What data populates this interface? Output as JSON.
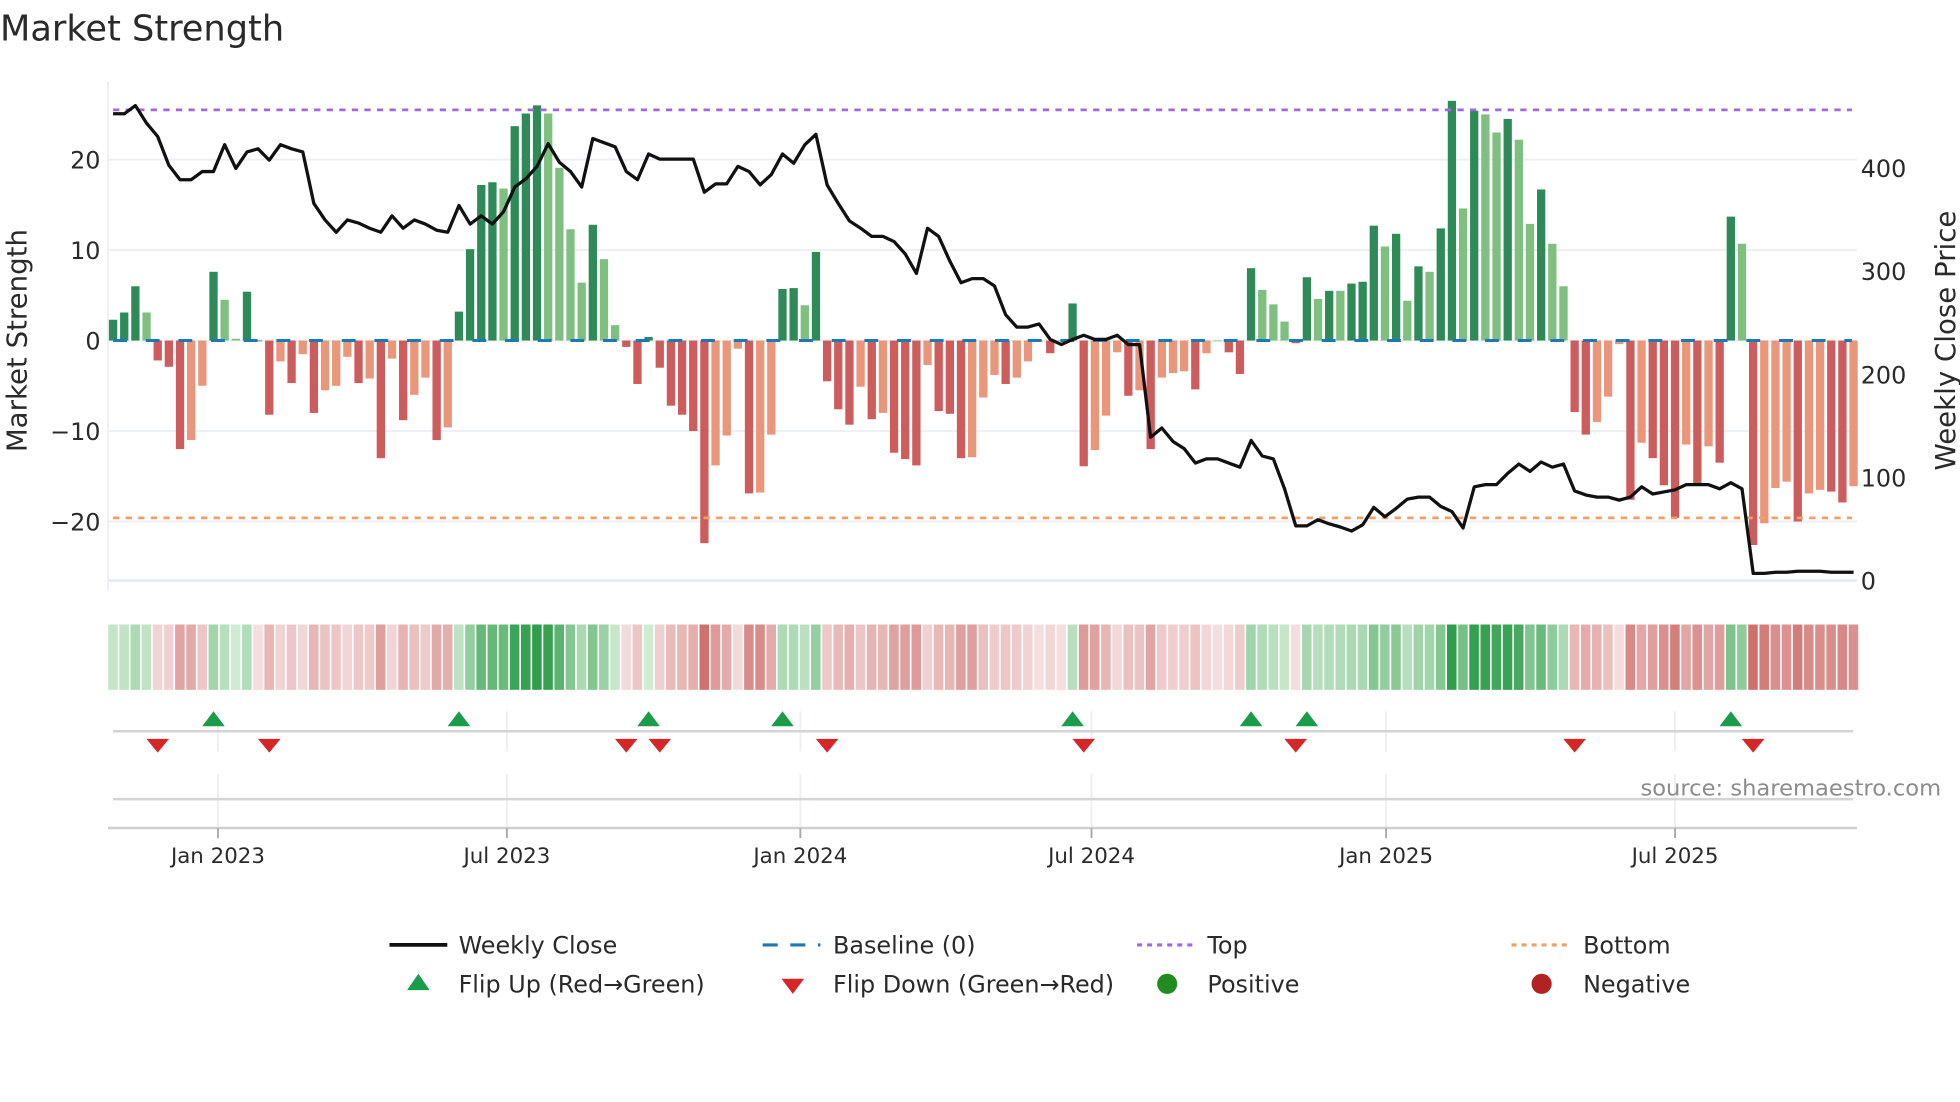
{
  "chart_data": {
    "type": "bar",
    "title": "Market Strength",
    "ylabel": "Market Strength",
    "y2label": "Weekly Close Price",
    "ylim": [
      -26.5,
      28.6
    ],
    "y2lim": [
      0,
      484
    ],
    "yticks": [
      {
        "v": 20,
        "label": "20"
      },
      {
        "v": 10,
        "label": "10"
      },
      {
        "v": 0,
        "label": "0"
      },
      {
        "v": -10,
        "label": "−10"
      },
      {
        "v": -20,
        "label": "−20"
      }
    ],
    "y2ticks": [
      {
        "v": 400,
        "label": "400"
      },
      {
        "v": 300,
        "label": "300"
      },
      {
        "v": 200,
        "label": "200"
      },
      {
        "v": 100,
        "label": "100"
      },
      {
        "v": 0,
        "label": "0"
      }
    ],
    "xticks": [
      {
        "week": 10.4,
        "label": "Jan 2023"
      },
      {
        "week": 36.3,
        "label": "Jul 2023"
      },
      {
        "week": 62.6,
        "label": "Jan 2024"
      },
      {
        "week": 88.7,
        "label": "Jul 2024"
      },
      {
        "week": 115.1,
        "label": "Jan 2025"
      },
      {
        "week": 141,
        "label": "Jul 2025"
      }
    ],
    "top_level": 25.5,
    "bottom_level": -19.6,
    "baseline": 0,
    "strength": [
      2.3,
      3.1,
      6.0,
      3.1,
      -2.2,
      -2.9,
      -12.0,
      -11.0,
      -5.0,
      7.6,
      4.5,
      0.2,
      5.4,
      0,
      -8.2,
      -2.3,
      -4.7,
      -1.5,
      -8.0,
      -5.5,
      -5.0,
      -1.8,
      -4.7,
      -4.2,
      -13.0,
      -2.0,
      -8.8,
      -6.0,
      -4.1,
      -11.0,
      -9.6,
      3.2,
      10.1,
      17.2,
      17.5,
      16.8,
      23.7,
      25.1,
      26.0,
      25.1,
      19.1,
      12.3,
      6.4,
      12.8,
      9.0,
      1.7,
      -0.7,
      -4.8,
      0.4,
      -3.0,
      -7.2,
      -8.2,
      -10.0,
      -22.4,
      -13.8,
      -10.5,
      -0.9,
      -16.9,
      -16.8,
      -10.4,
      5.7,
      5.8,
      3.9,
      9.8,
      -4.5,
      -7.6,
      -9.3,
      -5.1,
      -8.7,
      -8.0,
      -12.4,
      -13.1,
      -13.8,
      -2.7,
      -7.8,
      -8.1,
      -13.0,
      -12.9,
      -6.3,
      -3.8,
      -4.8,
      -4.1,
      -2.3,
      0,
      -1.4,
      0,
      4.1,
      -13.9,
      -12.1,
      -8.3,
      -1.3,
      -6.1,
      -5.5,
      -12.0,
      -4.1,
      -3.6,
      -3.4,
      -5.4,
      -1.4,
      0,
      -1.3,
      -3.7,
      8.0,
      5.6,
      4.0,
      2.1,
      -0.3,
      7.0,
      4.6,
      5.5,
      5.5,
      6.3,
      6.5,
      12.7,
      10.4,
      11.8,
      4.4,
      8.2,
      7.6,
      12.4,
      26.5,
      14.6,
      25.4,
      25.0,
      23.0,
      24.5,
      22.2,
      12.9,
      16.7,
      10.7,
      6.0,
      -7.9,
      -10.4,
      -9.0,
      -6.2,
      -0.4,
      -17.6,
      -11.3,
      -13.0,
      -16.0,
      -19.6,
      -11.5,
      -15.9,
      -11.7,
      -13.5,
      13.7,
      10.7,
      -22.6,
      -20.2,
      -16.3,
      -15.6,
      -20.0,
      -16.9,
      -16.5,
      -16.7,
      -17.9,
      -16.1
    ],
    "strong": [
      1,
      1,
      1,
      0,
      1,
      1,
      1,
      0,
      0,
      1,
      0,
      0,
      1,
      1,
      1,
      0,
      1,
      0,
      1,
      0,
      0,
      0,
      1,
      0,
      1,
      0,
      1,
      0,
      0,
      1,
      0,
      1,
      1,
      1,
      1,
      0,
      1,
      1,
      1,
      0,
      0,
      0,
      0,
      1,
      0,
      0,
      1,
      1,
      1,
      1,
      1,
      1,
      1,
      1,
      0,
      0,
      0,
      1,
      0,
      0,
      1,
      1,
      0,
      1,
      1,
      1,
      1,
      0,
      1,
      0,
      1,
      1,
      1,
      0,
      1,
      1,
      1,
      0,
      0,
      0,
      1,
      0,
      0,
      0,
      1,
      0,
      1,
      1,
      0,
      0,
      0,
      1,
      0,
      1,
      0,
      0,
      0,
      1,
      0,
      0,
      1,
      1,
      1,
      0,
      0,
      0,
      1,
      1,
      0,
      1,
      0,
      1,
      1,
      1,
      0,
      1,
      0,
      1,
      0,
      1,
      1,
      0,
      1,
      0,
      0,
      1,
      0,
      0,
      1,
      0,
      0,
      1,
      1,
      0,
      0,
      0,
      1,
      0,
      1,
      1,
      1,
      0,
      1,
      0,
      1,
      1,
      0,
      1,
      0,
      0,
      0,
      1,
      0,
      0,
      1,
      1,
      0
    ],
    "weekly_close": [
      453,
      453,
      461,
      444,
      431,
      403,
      389,
      389,
      397,
      397,
      423,
      400,
      416,
      419,
      408,
      423,
      419,
      416,
      366,
      350,
      338,
      350,
      347,
      342,
      338,
      354,
      342,
      350,
      346,
      340,
      338,
      364,
      346,
      354,
      346,
      358,
      382,
      390,
      402,
      424,
      406,
      397,
      382,
      429,
      425,
      421,
      397,
      389,
      414,
      409,
      409,
      409,
      409,
      377,
      385,
      385,
      402,
      397,
      384,
      394,
      414,
      405,
      423,
      433,
      384,
      366,
      349,
      342,
      334,
      334,
      329,
      317,
      298,
      342,
      334,
      310,
      289,
      293,
      293,
      286,
      258,
      246,
      246,
      249,
      234,
      229,
      234,
      238,
      234,
      234,
      238,
      229,
      229,
      139,
      148,
      135,
      128,
      114,
      118,
      118,
      114,
      110,
      136,
      121,
      118,
      89,
      53,
      53,
      59,
      55,
      52,
      48,
      54,
      71,
      62,
      70,
      79,
      81,
      81,
      72,
      67,
      51,
      91,
      93,
      93,
      104,
      113,
      106,
      115,
      110,
      113,
      87,
      83,
      81,
      81,
      78,
      81,
      91,
      84,
      86,
      88,
      93,
      93,
      93,
      89,
      95,
      89,
      7,
      7,
      8,
      8,
      9,
      9,
      9,
      8,
      8,
      8
    ],
    "flip_up_weeks": [
      10,
      32,
      49,
      61,
      87,
      103,
      108,
      146
    ],
    "flip_down_weeks": [
      5,
      15,
      47,
      50,
      65,
      88,
      107,
      132,
      148
    ],
    "legend": {
      "weekly_close": "Weekly Close",
      "baseline": "Baseline (0)",
      "top": "Top",
      "bottom": "Bottom",
      "flip_up": "Flip Up (Red→Green)",
      "flip_down": "Flip Down (Green→Red)",
      "positive": "Positive",
      "negative": "Negative"
    },
    "legend_placement": "bottom",
    "source": "source: sharemaestro.com",
    "colors": {
      "pos_strong": "#2e8b57",
      "pos_weak": "#7fbf7f",
      "neg_strong": "#cd5c5c",
      "neg_weak": "#e9967a",
      "line": "#111111",
      "baseline": "#1f77b4",
      "top": "#9c6ade",
      "bottom": "#f0a060",
      "flip_up": "#1a9c4a",
      "flip_down": "#d62728",
      "positive": "#228b22",
      "negative": "#b22222"
    }
  }
}
